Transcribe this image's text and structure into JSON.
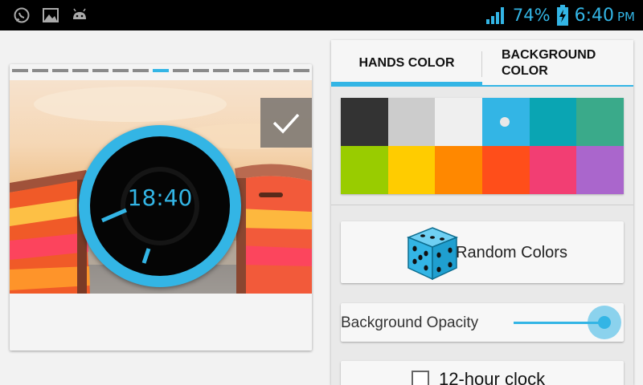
{
  "status_bar": {
    "battery_percent": "74%",
    "time": "6:40",
    "ampm": "PM",
    "left_icons": [
      "whatsapp-icon",
      "gallery-icon",
      "android-icon"
    ],
    "right_icons": [
      "signal-icon",
      "battery-charging-icon"
    ]
  },
  "preview": {
    "clock_time": "18:40",
    "page_indicator": {
      "count": 15,
      "active_index": 7
    },
    "confirm_icon": "checkmark-icon"
  },
  "tabs": {
    "hands_label": "HANDS COLOR",
    "background_label_line1": "BACKGROUND",
    "background_label_line2": "COLOR",
    "active": "hands"
  },
  "palette": {
    "colors": [
      "#333333",
      "#cccccc",
      "#efefef",
      "#33b5e5",
      "#0aa5b3",
      "#3aaa8a",
      "#99cc00",
      "#ffcc00",
      "#ff8800",
      "#ff4e1a",
      "#f23e73",
      "#aa66cc"
    ],
    "selected_index": 3
  },
  "random_button": {
    "label": "Random Colors",
    "icon": "dice-icon"
  },
  "opacity": {
    "label": "Background Opacity",
    "value": 1.0
  },
  "hour_clock": {
    "label": "12-hour clock",
    "checked": false
  },
  "accent_color": "#33b5e5"
}
